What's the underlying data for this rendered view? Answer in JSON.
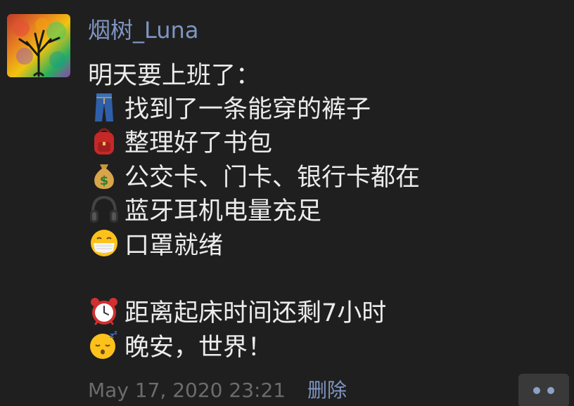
{
  "post": {
    "author": "烟树_Luna",
    "avatar_icon": "colorful-tree-painting",
    "lines": [
      {
        "icon": "",
        "text": "明天要上班了："
      },
      {
        "icon": "jeans-emoji",
        "text": "找到了一条能穿的裤子"
      },
      {
        "icon": "backpack-emoji",
        "text": "整理好了书包"
      },
      {
        "icon": "money-bag-emoji",
        "text": "公交卡、门卡、银行卡都在"
      },
      {
        "icon": "headphones-emoji",
        "text": "蓝牙耳机电量充足"
      },
      {
        "icon": "face-with-mask-emoji",
        "text": "口罩就绪"
      },
      {
        "icon": "",
        "text": ""
      },
      {
        "icon": "alarm-clock-emoji",
        "text": "距离起床时间还剩7小时"
      },
      {
        "icon": "sleeping-face-emoji",
        "text": "晚安，世界！"
      }
    ],
    "timestamp": "May 17, 2020 23:21",
    "delete_label": "删除",
    "more_icon": "ellipsis-icon"
  },
  "colors": {
    "background": "#1f1f1f",
    "author_link": "#7f95c2",
    "text": "#ececec",
    "timestamp": "#6c6c6c",
    "more_button_bg": "#393939"
  }
}
